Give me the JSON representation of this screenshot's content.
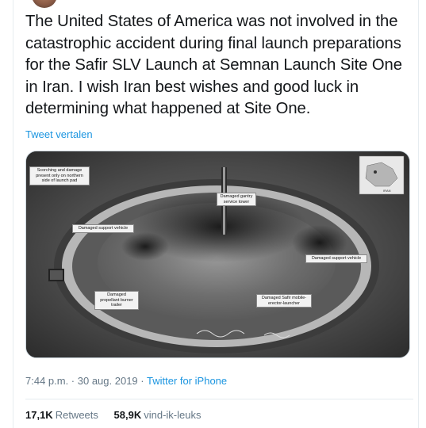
{
  "tweet": {
    "text": "The United States of America was not involved in the catastrophic accident during final launch preparations for the Safir SLV Launch at Semnan Launch Site One in Iran. I wish Iran best wishes and good luck in determining what happened at Site One.",
    "translate_label": "Tweet vertalen",
    "timestamp": "7:44 p.m. · 30 aug. 2019 · ",
    "source": "Twitter for iPhone"
  },
  "image_annotations": {
    "scorch": "Scorching and damage present only on northern side of launch pad",
    "gantry": "Damaged gantry service tower",
    "support_left": "Damaged support vehicle",
    "support_right": "Damaged support vehicle",
    "propellant": "Damaged propellant burner trailer",
    "erector": "Damaged Safir mobile-erector-launcher",
    "map_label": "IRAN"
  },
  "stats": {
    "retweets_count": "17,1K",
    "retweets_label": "Retweets",
    "likes_count": "58,9K",
    "likes_label": "vind-ik-leuks"
  },
  "colors": {
    "link": "#1b95e0",
    "secondary_text": "#657786",
    "border": "#e6ecf0"
  }
}
